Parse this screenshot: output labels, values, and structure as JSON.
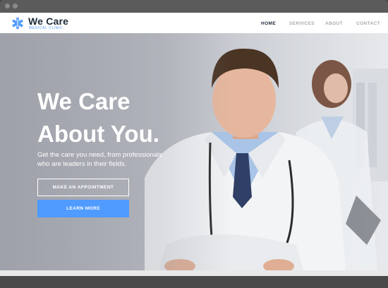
{
  "brand": {
    "name": "We Care",
    "tagline": "MEDICAL CLINIC"
  },
  "nav": {
    "items": [
      "HOME",
      "SERVICES",
      "ABOUT",
      "CONTACT"
    ],
    "active": "HOME"
  },
  "hero": {
    "headline_line1": "We Care",
    "headline_line2": "About You.",
    "subtext_line1": "Get the care you need, from professionals",
    "subtext_line2": "who are leaders in their fields.",
    "primary_button": "MAKE AN APPOINTMENT",
    "secondary_button": "LEARN MORE"
  },
  "colors": {
    "accent": "#4f9bff",
    "dark": "#1d2b3a",
    "nav_inactive": "#a9a9a9"
  },
  "icons": {
    "logo": "star-of-life-icon"
  }
}
